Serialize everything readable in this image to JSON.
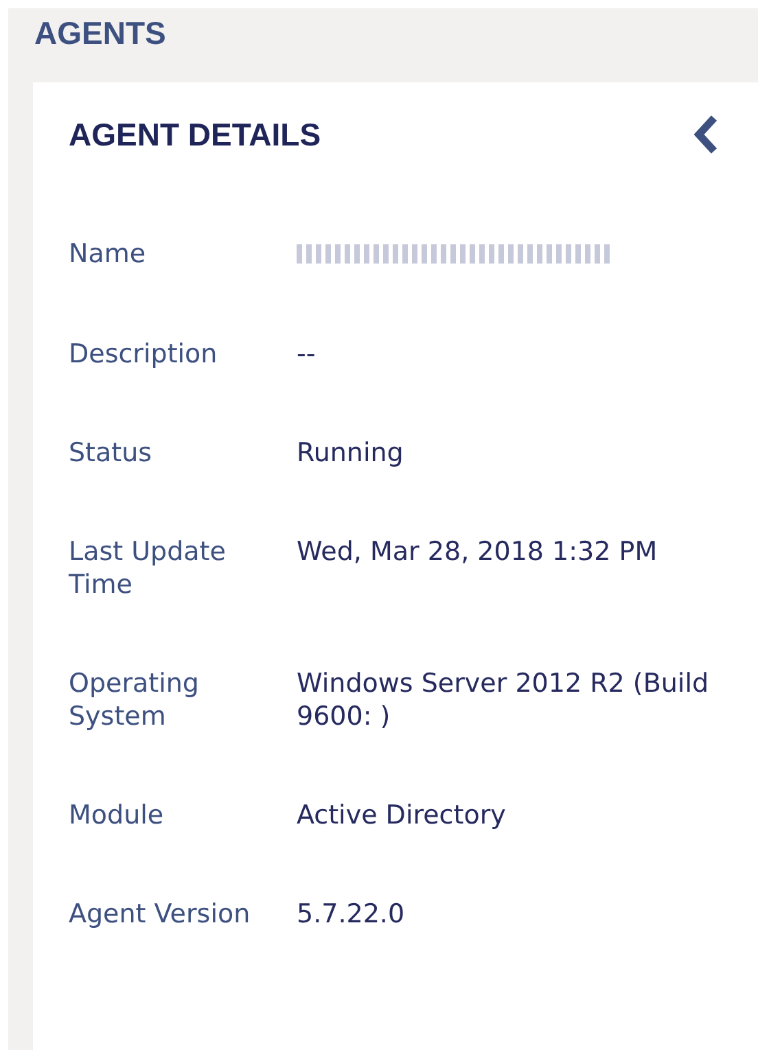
{
  "page": {
    "title": "AGENTS"
  },
  "panel": {
    "title": "AGENT DETAILS",
    "fields": [
      {
        "label": "Name",
        "redacted": true
      },
      {
        "label": "Description",
        "value": "--",
        "redacted": false
      },
      {
        "label": "Status",
        "value": "Running",
        "redacted": false
      },
      {
        "label": "Last Update Time",
        "value": "Wed, Mar 28, 2018 1:32 PM",
        "redacted": false
      },
      {
        "label": "Operating System",
        "value": "Windows Server 2012 R2 (Build 9600: )",
        "redacted": false
      },
      {
        "label": "Module",
        "value": "Active Directory",
        "redacted": false
      },
      {
        "label": "Agent Version",
        "value": "5.7.22.0",
        "redacted": false
      }
    ]
  }
}
